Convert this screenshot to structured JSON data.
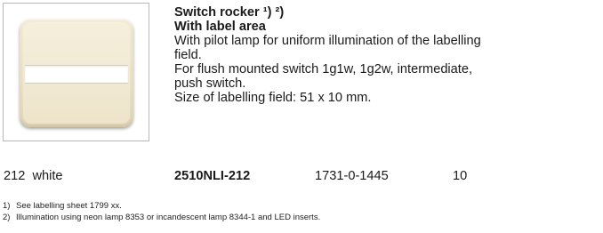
{
  "product": {
    "title_line1": "Switch rocker ¹) ²)",
    "title_line2": "With label area",
    "desc": [
      "With pilot lamp for uniform illumination of the labelling",
      "field.",
      "For flush mounted switch 1g1w, 1g2w, intermediate,",
      "push switch.",
      "Size of labelling field: 51 x 10 mm."
    ],
    "image_alt": "Switch rocker with label area, white"
  },
  "order": {
    "colour": "212  white",
    "article_no": "2510NLI-212",
    "ean": "1731-0-1445",
    "pack": "10"
  },
  "footnotes": [
    {
      "num": "1)",
      "text": "See labelling sheet 1799 xx."
    },
    {
      "num": "2)",
      "text": "Illumination using neon lamp 8353 or incandescent lamp 8344-1 and LED inserts."
    }
  ],
  "colors": {
    "rocker": "#ede4ca",
    "frame_border": "#b8b8b8",
    "text": "#1a1a1a"
  }
}
